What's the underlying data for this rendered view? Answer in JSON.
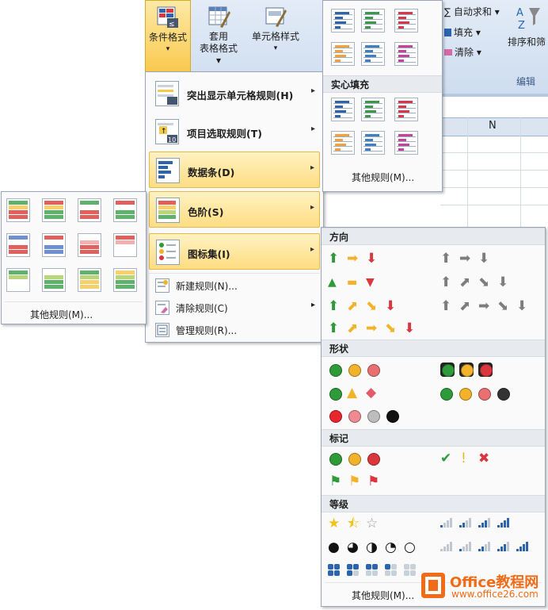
{
  "ribbon": {
    "conditional_format": {
      "line1": "条件格式",
      "line2": "▾"
    },
    "table_format": {
      "line1": "套用",
      "line2": "表格格式 ▾"
    },
    "cell_style": {
      "line1": "单元格样式",
      "line2": "▾"
    },
    "autosum": "∑ 自动求和 ▾",
    "fill": "填充 ▾",
    "clear": "清除 ▾",
    "sort": "排序和筛",
    "group_edit": "编辑"
  },
  "sheet": {
    "column_n": "N"
  },
  "main_menu": {
    "items": [
      {
        "label": "突出显示单元格规则(H)",
        "arrow": "▸"
      },
      {
        "label": "项目选取规则(T)",
        "arrow": "▸"
      },
      {
        "label": "数据条(D)",
        "arrow": "▸"
      },
      {
        "label": "色阶(S)",
        "arrow": "▸"
      },
      {
        "label": "图标集(I)",
        "arrow": "▸"
      }
    ],
    "small": [
      {
        "label": "新建规则(N)..."
      },
      {
        "label": "清除规则(C)",
        "arrow": "▸"
      },
      {
        "label": "管理规则(R)..."
      }
    ]
  },
  "databar_menu": {
    "solid_fill": "实心填充",
    "more": "其他规则(M)..."
  },
  "colorscale_menu": {
    "more": "其他规则(M)..."
  },
  "iconset_menu": {
    "sections": {
      "direction": "方向",
      "shape": "形状",
      "marks": "标记",
      "rating": "等级"
    },
    "glyphs": {
      "up": "⬆",
      "right": "➡",
      "down": "⬇",
      "upright": "⬈",
      "downright": "⬊",
      "tri_up": "▲",
      "dash": "▬",
      "tri_down": "▼",
      "triangle": "▲",
      "diamond": "◆",
      "check": "✔",
      "excl": "!",
      "cross": "✖",
      "flag": "⚑",
      "star_full": "★",
      "star_half": "⯪",
      "star_empty": "☆",
      "c_full": "●",
      "c_3q": "◕",
      "c_half": "◑",
      "c_1q": "◔",
      "c_empty": "○"
    },
    "more": "其他规则(M)..."
  },
  "watermark": {
    "brand": "Office教程网",
    "url": "www.office26.com"
  },
  "colors": {
    "green": "#2e9a3a",
    "yellow": "#f2b32a",
    "red": "#d9363e",
    "gray": "#7d7d7d",
    "blue": "#2d64b0",
    "highlight": "#fedd82"
  }
}
